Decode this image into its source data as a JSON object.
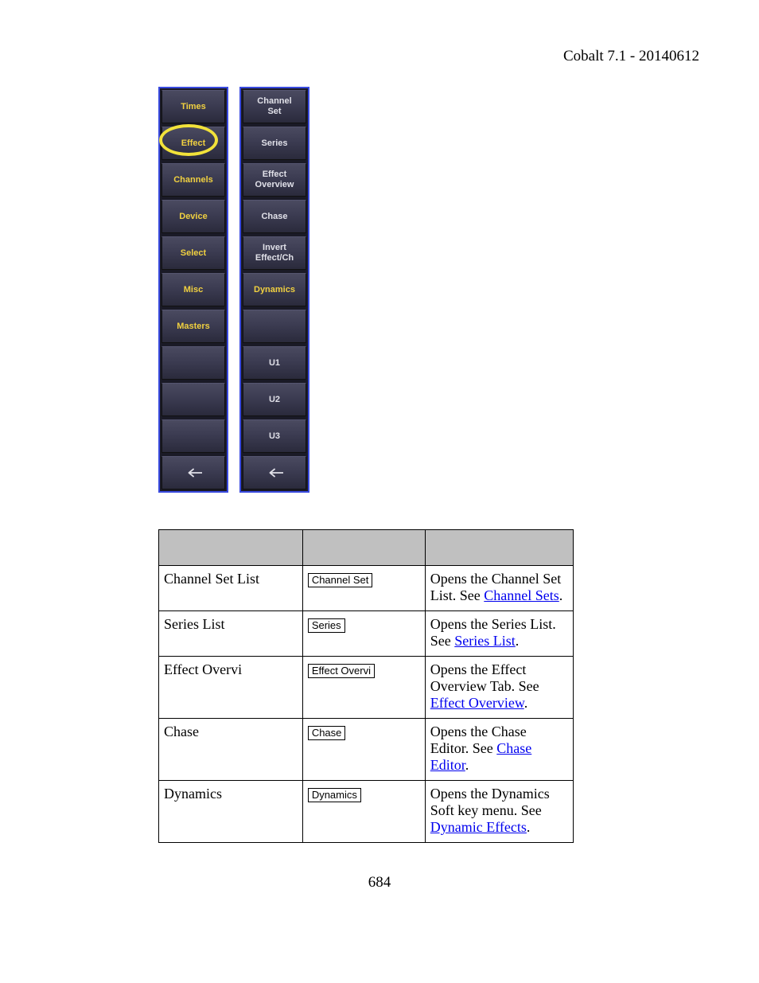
{
  "header": {
    "text": "Cobalt 7.1 - 20140612"
  },
  "left_panel": {
    "items": [
      {
        "label": "Times"
      },
      {
        "label": "Effect",
        "circled": true
      },
      {
        "label": "Channels"
      },
      {
        "label": "Device"
      },
      {
        "label": "Select"
      },
      {
        "label": "Misc"
      },
      {
        "label": "Masters"
      },
      {
        "label": ""
      },
      {
        "label": ""
      },
      {
        "label": ""
      },
      {
        "label": "←",
        "arrow": true
      }
    ]
  },
  "right_panel": {
    "items": [
      {
        "label": "Channel\nSet"
      },
      {
        "label": "Series"
      },
      {
        "label": "Effect\nOverview"
      },
      {
        "label": "Chase"
      },
      {
        "label": "Invert\nEffect/Ch"
      },
      {
        "label": "Dynamics",
        "yellow": true
      },
      {
        "label": ""
      },
      {
        "label": "U1"
      },
      {
        "label": "U2"
      },
      {
        "label": "U3"
      },
      {
        "label": "←",
        "arrow": true
      }
    ]
  },
  "table": {
    "rows": [
      {
        "name": "Channel Set List",
        "key": "Channel Set",
        "desc_pre": "Opens the Channel Set List. See ",
        "link": "Channel Sets",
        "desc_post": "."
      },
      {
        "name": "Series List",
        "key": "Series",
        "desc_pre": "Opens the Series List. See ",
        "link": "Series List",
        "desc_post": "."
      },
      {
        "name": "Effect Overvi",
        "key": "Effect Overvi",
        "desc_pre": "Opens the Effect Overview Tab. See ",
        "link": "Effect Overview",
        "desc_post": "."
      },
      {
        "name": "Chase",
        "key": "Chase",
        "desc_pre": "Opens the Chase Editor. See ",
        "link": "Chase Editor",
        "desc_post": "."
      },
      {
        "name": "Dynamics",
        "key": "Dynamics",
        "desc_pre": "Opens the Dynamics Soft key menu. See ",
        "link": "Dynamic Effects",
        "desc_post": "."
      }
    ]
  },
  "page_number": "684"
}
